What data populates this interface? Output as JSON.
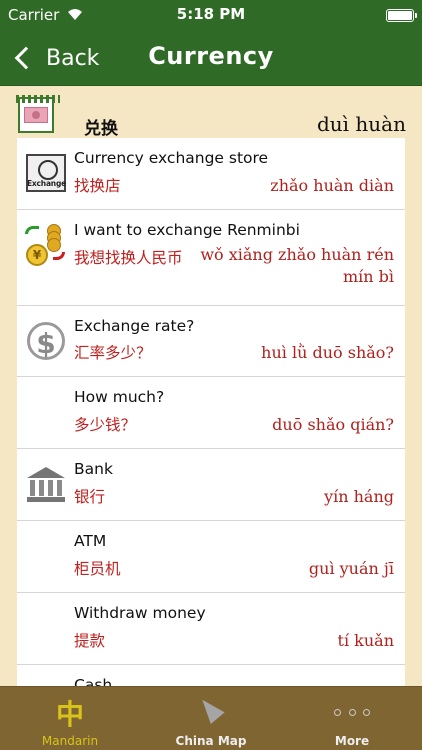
{
  "status": {
    "carrier": "Carrier",
    "time": "5:18 PM"
  },
  "nav": {
    "back_label": "Back",
    "title": "Currency"
  },
  "section": {
    "chinese": "兑换",
    "pinyin": "duì huàn"
  },
  "rows": [
    {
      "english": "Currency exchange store",
      "chinese": "找换店",
      "pinyin": "zhǎo huàn diàn",
      "icon": "exchange-store-icon",
      "icon_label": "Exchange"
    },
    {
      "english": "I want to exchange Renminbi",
      "chinese": "我想找换人民币",
      "pinyin": "wǒ xiǎng zhǎo huàn rén mín bì",
      "icon": "coins-exchange-icon",
      "icon_label": "¥"
    },
    {
      "english": "Exchange rate?",
      "chinese": "汇率多少？",
      "pinyin": "huì lǜ duō shǎo?",
      "icon": "globe-dollar-icon"
    },
    {
      "english": "How much?",
      "chinese": "多少钱？",
      "pinyin": "duō shǎo qián?"
    },
    {
      "english": "Bank",
      "chinese": "银行",
      "pinyin": "yín háng",
      "icon": "bank-icon"
    },
    {
      "english": "ATM",
      "chinese": "柜员机",
      "pinyin": "guì yuán jī"
    },
    {
      "english": "Withdraw money",
      "chinese": "提款",
      "pinyin": "tí kuǎn"
    },
    {
      "english": "Cash",
      "chinese": "",
      "pinyin": ""
    }
  ],
  "tabs": [
    {
      "label": "Mandarin",
      "glyph": "中",
      "icon": "mandarin-icon"
    },
    {
      "label": "China Map",
      "icon": "map-arrow-icon"
    },
    {
      "label": "More",
      "icon": "more-dots-icon"
    }
  ],
  "colors": {
    "nav_green": "#2f6a26",
    "tab_brown": "#7f6531",
    "pinyin_red": "#b1201c",
    "active_tab": "#d7c31a",
    "background": "#f5e6c4"
  }
}
